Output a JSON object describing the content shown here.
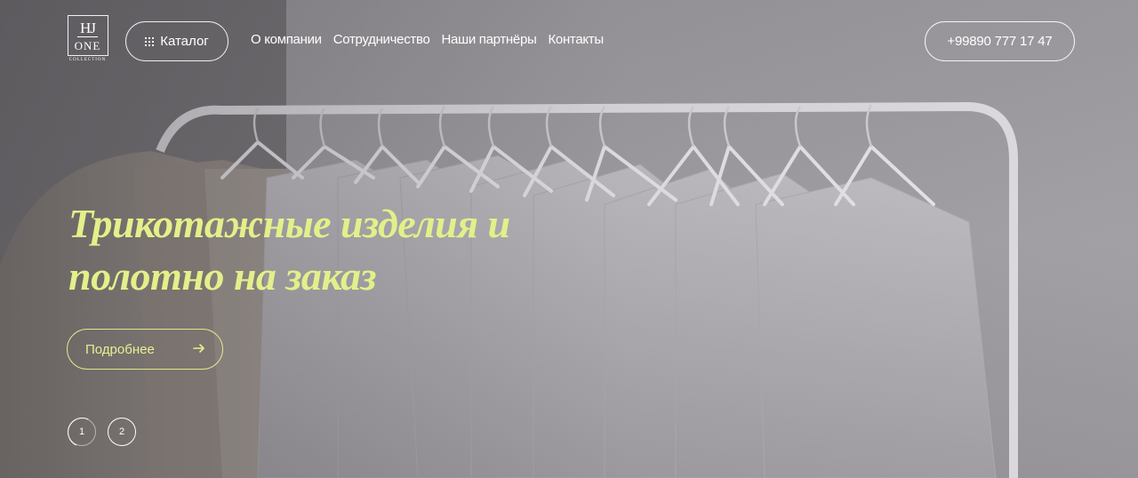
{
  "logo": {
    "monogram": "HJ",
    "word": "ONE",
    "sub": "COLLECTION"
  },
  "header": {
    "catalog_label": "Каталог",
    "nav": [
      "О компании",
      "Сотрудничество",
      "Наши партнёры",
      "Контакты"
    ],
    "phone": "+99890 777 17 47"
  },
  "hero": {
    "headline_line1": "Трикотажные изделия и",
    "headline_line2": "полотно на заказ",
    "cta_label": "Подробнее",
    "slides": [
      "1",
      "2"
    ],
    "active_slide": "1"
  },
  "icons": {
    "catalog": "grid-dots-icon",
    "cta": "arrow-right-icon"
  },
  "colors": {
    "accent": "#e3f08a",
    "text": "#ffffff",
    "overlay": "#7d7b7e"
  }
}
